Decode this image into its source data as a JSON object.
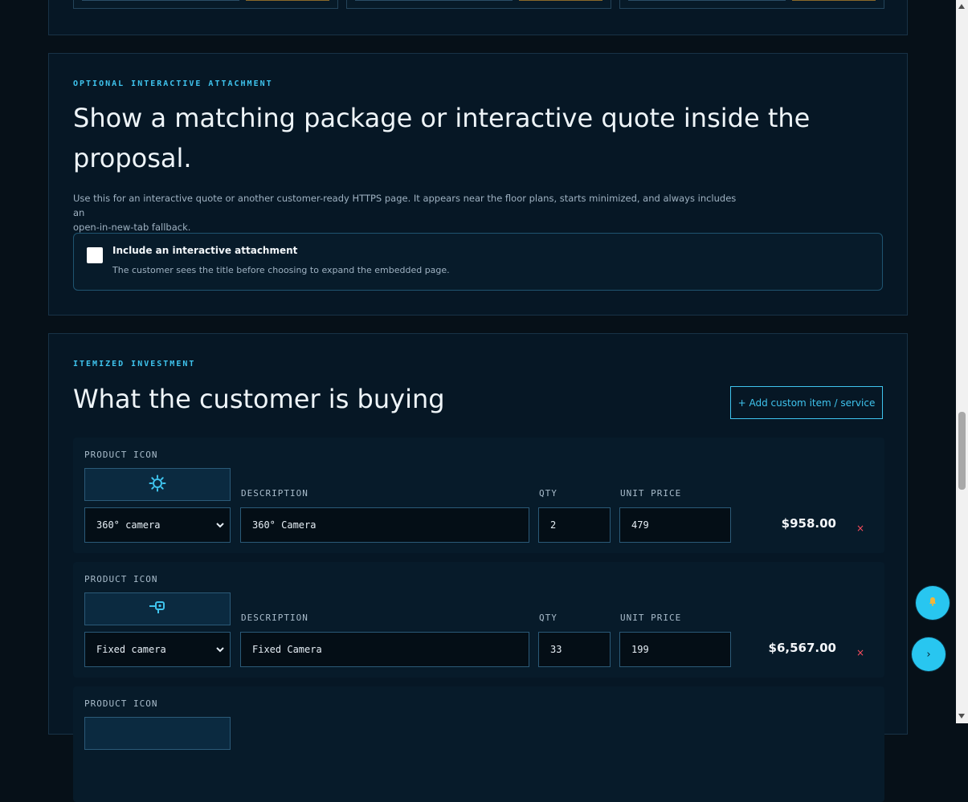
{
  "attachment": {
    "eyebrow": "OPTIONAL INTERACTIVE ATTACHMENT",
    "title_line1": "Show a matching package or interactive quote inside the",
    "title_line2": "proposal.",
    "description_line1": "Use this for an interactive quote or another customer-ready HTTPS page. It appears near the floor plans, starts minimized, and always includes an",
    "description_line2": "open-in-new-tab fallback.",
    "checkbox_label": "Include an interactive attachment",
    "checkbox_help": "The customer sees the title before choosing to expand the embedded page.",
    "checked": false
  },
  "investment": {
    "eyebrow": "ITEMIZED INVESTMENT",
    "title": "What the customer is buying",
    "add_button": "+ Add custom item / service",
    "labels": {
      "product_icon": "PRODUCT ICON",
      "description": "DESCRIPTION",
      "qty": "QTY",
      "unit_price": "UNIT PRICE"
    },
    "items": [
      {
        "icon": "sun-gear-icon",
        "product": "360° camera",
        "description": "360° Camera",
        "qty": "2",
        "unit_price": "479",
        "total": "$958.00",
        "remove": "×"
      },
      {
        "icon": "fixed-camera-icon",
        "product": "Fixed camera",
        "description": "Fixed Camera",
        "qty": "33",
        "unit_price": "199",
        "total": "$6,567.00",
        "remove": "×"
      },
      {
        "icon": "",
        "product": "",
        "description": "",
        "qty": "",
        "unit_price": "",
        "total": "",
        "remove": ""
      }
    ]
  },
  "fabs": {
    "notify_icon": "bell-icon",
    "next_label": "›"
  },
  "colors": {
    "accent": "#3fc4ee",
    "background": "#061018",
    "panel": "#061725",
    "danger": "#ff4d5e"
  }
}
